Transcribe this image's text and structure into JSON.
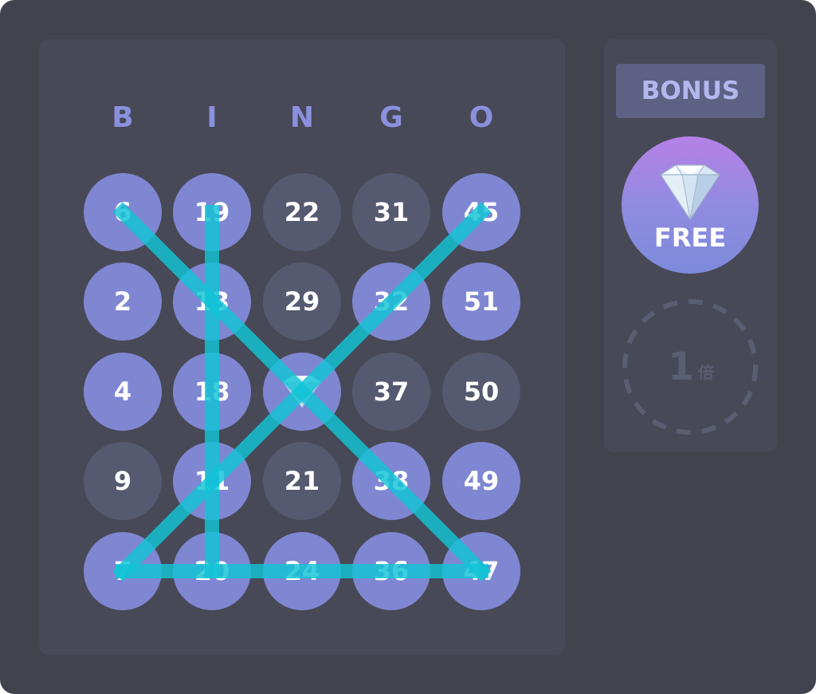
{
  "board": {
    "headers": [
      "B",
      "I",
      "N",
      "G",
      "O"
    ],
    "cells": [
      [
        {
          "label": "6",
          "state": "marked"
        },
        {
          "label": "19",
          "state": "marked"
        },
        {
          "label": "22",
          "state": "unmarked"
        },
        {
          "label": "31",
          "state": "unmarked"
        },
        {
          "label": "45",
          "state": "marked"
        }
      ],
      [
        {
          "label": "2",
          "state": "marked"
        },
        {
          "label": "13",
          "state": "marked"
        },
        {
          "label": "29",
          "state": "unmarked"
        },
        {
          "label": "32",
          "state": "marked"
        },
        {
          "label": "51",
          "state": "marked"
        }
      ],
      [
        {
          "label": "4",
          "state": "marked"
        },
        {
          "label": "18",
          "state": "marked"
        },
        {
          "label": "",
          "state": "free",
          "icon": "diamond-icon"
        },
        {
          "label": "37",
          "state": "unmarked"
        },
        {
          "label": "50",
          "state": "unmarked"
        }
      ],
      [
        {
          "label": "9",
          "state": "unmarked"
        },
        {
          "label": "11",
          "state": "marked"
        },
        {
          "label": "21",
          "state": "unmarked"
        },
        {
          "label": "38",
          "state": "marked"
        },
        {
          "label": "49",
          "state": "marked"
        }
      ],
      [
        {
          "label": "7",
          "state": "marked"
        },
        {
          "label": "20",
          "state": "marked"
        },
        {
          "label": "24",
          "state": "marked"
        },
        {
          "label": "36",
          "state": "marked"
        },
        {
          "label": "47",
          "state": "marked"
        }
      ]
    ],
    "winning_lines": [
      {
        "name": "column-I",
        "from": [
          0,
          1
        ],
        "to": [
          4,
          1
        ]
      },
      {
        "name": "row-5",
        "from": [
          4,
          0
        ],
        "to": [
          4,
          4
        ]
      },
      {
        "name": "diagonal-down",
        "from": [
          0,
          0
        ],
        "to": [
          4,
          4
        ]
      },
      {
        "name": "diagonal-up",
        "from": [
          4,
          0
        ],
        "to": [
          0,
          4
        ]
      }
    ]
  },
  "bonus": {
    "label": "BONUS",
    "free_label": "FREE",
    "free_icon": "diamond-icon",
    "multiplier_value": "1",
    "multiplier_unit": "倍"
  },
  "colors": {
    "background": "#41434d",
    "panel": "#474956",
    "marked_ball": "#7f86d2",
    "unmarked_ball": "#565a70",
    "win_line": "#10c4d6",
    "header_letter": "#8a90de"
  }
}
